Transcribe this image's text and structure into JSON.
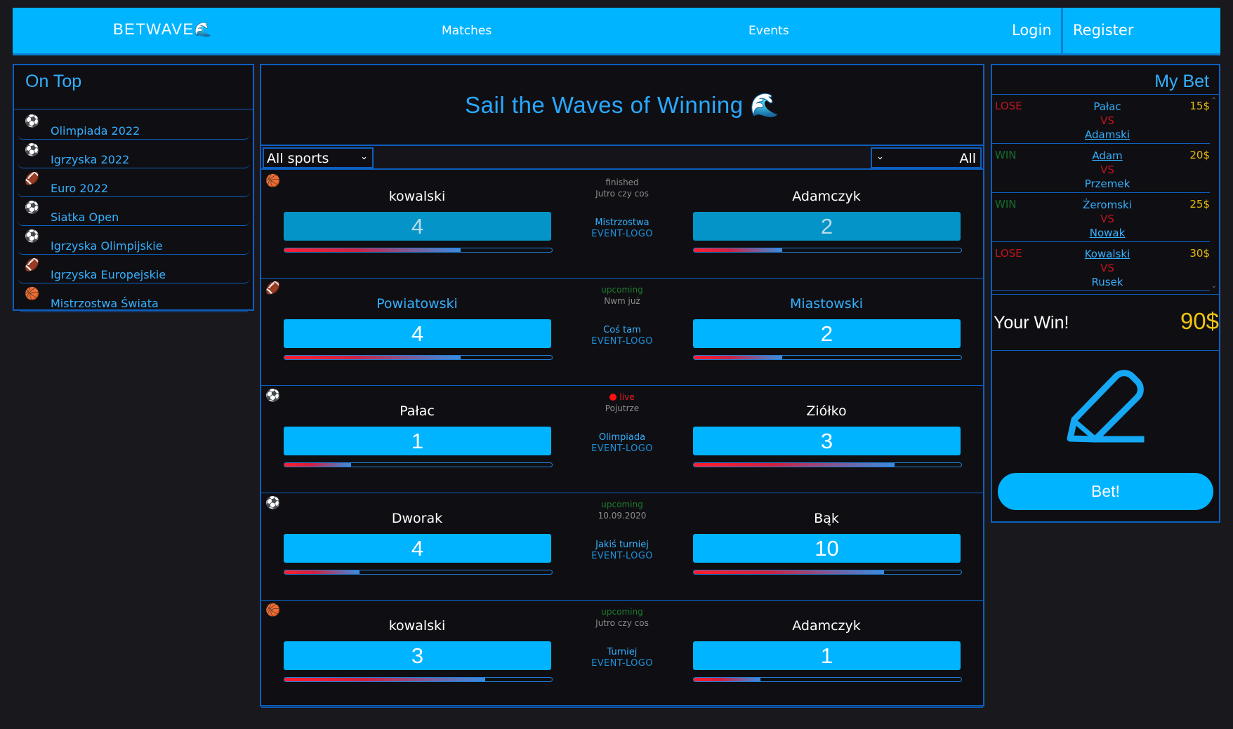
{
  "nav": {
    "brand": "BETWAVE",
    "brand_icon": "🌊",
    "links": [
      "Matches",
      "Events"
    ],
    "login": "Login",
    "register": "Register"
  },
  "ontop": {
    "title": "On Top",
    "items": [
      {
        "icon": "multi-sport-icon",
        "glyph": "⚽",
        "label": "Olimpiada 2022"
      },
      {
        "icon": "multi-sport-icon",
        "glyph": "⚽",
        "label": "Igrzyska 2022"
      },
      {
        "icon": "american-football-icon",
        "glyph": "🏈",
        "label": "Euro 2022"
      },
      {
        "icon": "soccer-ball-icon",
        "glyph": "⚽",
        "label": "Siatka Open"
      },
      {
        "icon": "soccer-ball-icon",
        "glyph": "⚽",
        "label": "Igrzyska Olimpijskie"
      },
      {
        "icon": "american-football-icon",
        "glyph": "🏈",
        "label": "Igrzyska Europejskie"
      },
      {
        "icon": "basketball-icon",
        "glyph": "🏀",
        "label": "Mistrzostwa Świata"
      }
    ]
  },
  "main": {
    "title": "Sail the Waves of Winning 🌊",
    "filters": {
      "sport": "All sports",
      "status": "All"
    },
    "matches": [
      {
        "sport_icon": "basketball-icon",
        "glyph": "🏀",
        "status": "finished",
        "status_class": "st-finished",
        "when": "Jutro czy cos",
        "event": "Mistrzostwa",
        "logo": "EVENT-LOGO",
        "team_a": "kowalski",
        "team_b": "Adamczyk",
        "score_a": "4",
        "score_b": "2",
        "progress_a": 0.66,
        "progress_b": 0.33,
        "finished": true,
        "highlight": false
      },
      {
        "sport_icon": "american-football-icon",
        "glyph": "🏈",
        "status": "upcoming",
        "status_class": "st-upcoming",
        "when": "Nwm już",
        "event": "Coś tam",
        "logo": "EVENT-LOGO",
        "team_a": "Powiatowski",
        "team_b": "Miastowski",
        "score_a": "4",
        "score_b": "2",
        "progress_a": 0.66,
        "progress_b": 0.33,
        "finished": false,
        "highlight": true
      },
      {
        "sport_icon": "multi-sport-icon",
        "glyph": "⚽",
        "status": "live",
        "status_class": "st-live",
        "when": "Pojutrze",
        "event": "Olimpiada",
        "logo": "EVENT-LOGO",
        "team_a": "Pałac",
        "team_b": "Ziółko",
        "score_a": "1",
        "score_b": "3",
        "progress_a": 0.25,
        "progress_b": 0.75,
        "finished": false,
        "highlight": false
      },
      {
        "sport_icon": "soccer-ball-icon",
        "glyph": "⚽",
        "status": "upcoming",
        "status_class": "st-upcoming",
        "when": "10.09.2020",
        "event": "Jakiś turniej",
        "logo": "EVENT-LOGO",
        "team_a": "Dworak",
        "team_b": "Bąk",
        "score_a": "4",
        "score_b": "10",
        "progress_a": 0.28,
        "progress_b": 0.71,
        "finished": false,
        "highlight": false
      },
      {
        "sport_icon": "basketball-icon",
        "glyph": "🏀",
        "status": "upcoming",
        "status_class": "st-upcoming",
        "when": "Jutro czy cos",
        "event": "Turniej",
        "logo": "EVENT-LOGO",
        "team_a": "kowalski",
        "team_b": "Adamczyk",
        "score_a": "3",
        "score_b": "1",
        "progress_a": 0.75,
        "progress_b": 0.25,
        "finished": false,
        "highlight": false
      }
    ]
  },
  "mybet": {
    "title": "My Bet",
    "bets": [
      {
        "result": "LOSE",
        "team_a": "Pałac",
        "vs": "VS",
        "team_b": "Adamski",
        "selected": "b",
        "amount": "15$"
      },
      {
        "result": "WIN",
        "team_a": "Adam",
        "vs": "VS",
        "team_b": "Przemek",
        "selected": "a",
        "amount": "20$"
      },
      {
        "result": "WIN",
        "team_a": "Żeromski",
        "vs": "VS",
        "team_b": "Nowak",
        "selected": "b",
        "amount": "25$"
      },
      {
        "result": "LOSE",
        "team_a": "Kowalski",
        "vs": "VS",
        "team_b": "Rusek",
        "selected": "a",
        "amount": "30$"
      }
    ],
    "win_label": "Your Win!",
    "win_value": "90$",
    "bet_button": "Bet!"
  },
  "colors": {
    "accent": "#00b4ff",
    "border": "#0d5fc0",
    "lose": "#c0141c",
    "win": "#156f2a",
    "money": "#f2c40f"
  }
}
